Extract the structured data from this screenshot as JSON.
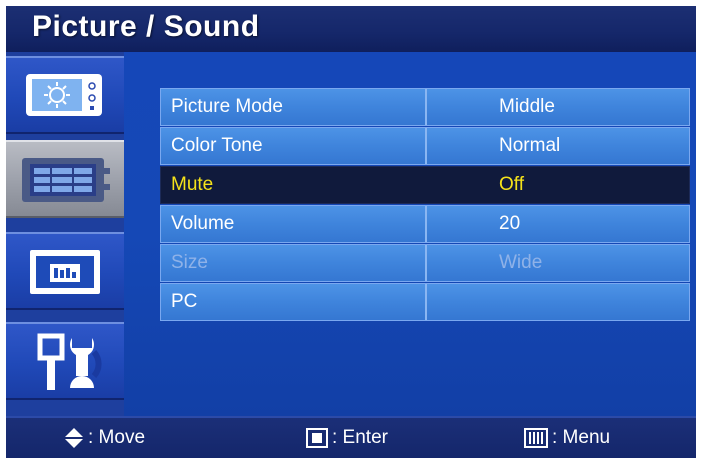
{
  "title": "Picture / Sound",
  "sidebar": {
    "items": [
      {
        "icon": "picture-icon",
        "active": false
      },
      {
        "icon": "sound-icon",
        "active": true
      },
      {
        "icon": "pc-icon",
        "active": false
      },
      {
        "icon": "tools-icon",
        "active": false
      }
    ]
  },
  "menu": {
    "rows": [
      {
        "label": "Picture Mode",
        "value": "Middle",
        "state": "normal"
      },
      {
        "label": "Color Tone",
        "value": "Normal",
        "state": "normal"
      },
      {
        "label": "Mute",
        "value": "Off",
        "state": "selected"
      },
      {
        "label": "Volume",
        "value": "20",
        "state": "normal"
      },
      {
        "label": "Size",
        "value": "Wide",
        "state": "disabled"
      },
      {
        "label": "PC",
        "value": "",
        "state": "normal"
      }
    ]
  },
  "footer": {
    "move_label": ": Move",
    "enter_label": ": Enter",
    "menu_label": ": Menu"
  },
  "colors": {
    "selected_text": "#f5e21a",
    "panel_bg": "#1547b8",
    "row_bg": "#4d93e6"
  }
}
